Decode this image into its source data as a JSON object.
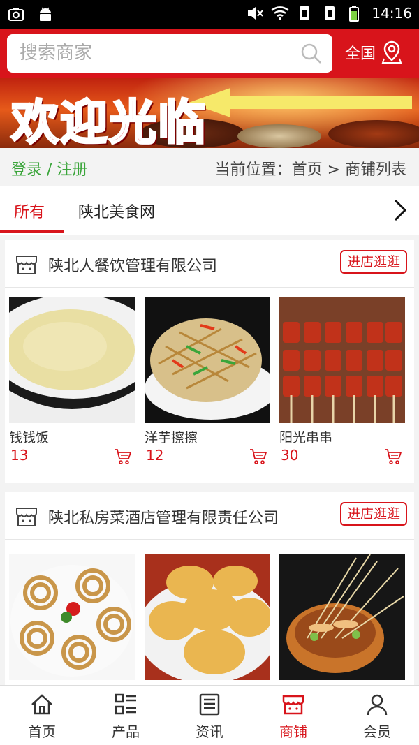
{
  "status_bar": {
    "time": "14:16"
  },
  "header": {
    "search_placeholder": "搜索商家",
    "region": "全国"
  },
  "banner": {
    "text": "欢迎光临"
  },
  "crumb_bar": {
    "login": "登录 / 注册",
    "breadcrumb": "当前位置：首页 > 商铺列表"
  },
  "tabs": [
    {
      "label": "所有",
      "active": true
    },
    {
      "label": "陕北美食网",
      "active": false
    }
  ],
  "shops": [
    {
      "name": "陕北人餐饮管理有限公司",
      "visit_label": "进店逛逛",
      "products": [
        {
          "name": "钱钱饭",
          "price": "13",
          "image": "porridge"
        },
        {
          "name": "洋芋擦擦",
          "price": "12",
          "image": "potato-shreds"
        },
        {
          "name": "阳光串串",
          "price": "30",
          "image": "skewers"
        }
      ]
    },
    {
      "name": "陕北私房菜酒店管理有限责任公司",
      "visit_label": "进店逛逛",
      "products": [
        {
          "name": "",
          "price": "",
          "image": "spiral-pastry"
        },
        {
          "name": "",
          "price": "",
          "image": "fried-cakes"
        },
        {
          "name": "",
          "price": "",
          "image": "bowl-skewers"
        }
      ]
    }
  ],
  "bottom_nav": [
    {
      "label": "首页",
      "icon": "home-icon",
      "active": false
    },
    {
      "label": "产品",
      "icon": "grid-list-icon",
      "active": false
    },
    {
      "label": "资讯",
      "icon": "news-icon",
      "active": false
    },
    {
      "label": "商铺",
      "icon": "store-icon",
      "active": true
    },
    {
      "label": "会员",
      "icon": "user-icon",
      "active": false
    }
  ],
  "colors": {
    "brand_red": "#d8141b",
    "login_green": "#3aa53a"
  }
}
